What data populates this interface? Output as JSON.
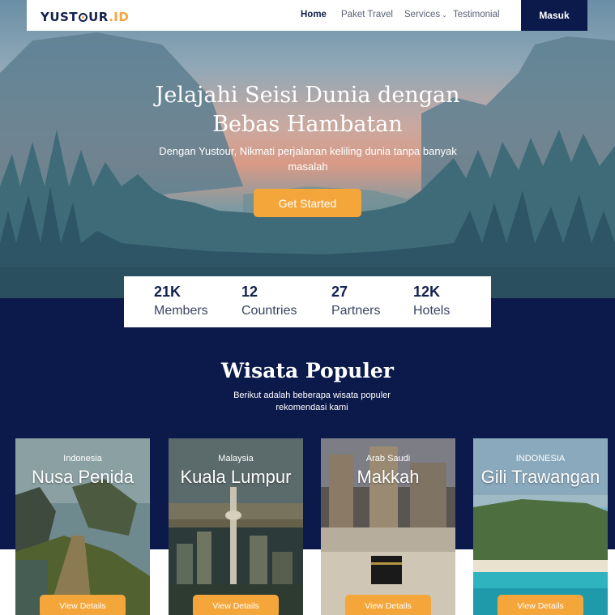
{
  "nav": {
    "logo_main": "YUST",
    "logo_after": "UR",
    "logo_accent": ".ID",
    "links": [
      {
        "label": "Home"
      },
      {
        "label": "Paket Travel"
      },
      {
        "label": "Services"
      },
      {
        "label": "Testimonial"
      }
    ],
    "login_label": "Masuk"
  },
  "hero": {
    "title_line1": "Jelajahi Seisi Dunia dengan",
    "title_line2": "Bebas Hambatan",
    "subtitle": "Dengan Yustour, Nikmati perjalanan keliling dunia tanpa banyak masalah",
    "cta_label": "Get Started"
  },
  "stats": [
    {
      "value": "21K",
      "label": "Members"
    },
    {
      "value": "12",
      "label": "Countries"
    },
    {
      "value": "27",
      "label": "Partners"
    },
    {
      "value": "12K",
      "label": "Hotels"
    }
  ],
  "popular": {
    "title": "Wisata Populer",
    "subtitle": "Berikut adalah beberapa wisata populer rekomendasi kami",
    "cards": [
      {
        "country": "Indonesia",
        "name": "Nusa Penida",
        "button": "View Details"
      },
      {
        "country": "Malaysia",
        "name": "Kuala Lumpur",
        "button": "View Details"
      },
      {
        "country": "Arab Saudi",
        "name": "Makkah",
        "button": "View Details"
      },
      {
        "country": "INDONESIA",
        "name": "Gili Trawangan",
        "button": "View Details"
      }
    ]
  },
  "colors": {
    "navy": "#0c1a4b",
    "accent": "#f5a63a",
    "white": "#ffffff"
  }
}
